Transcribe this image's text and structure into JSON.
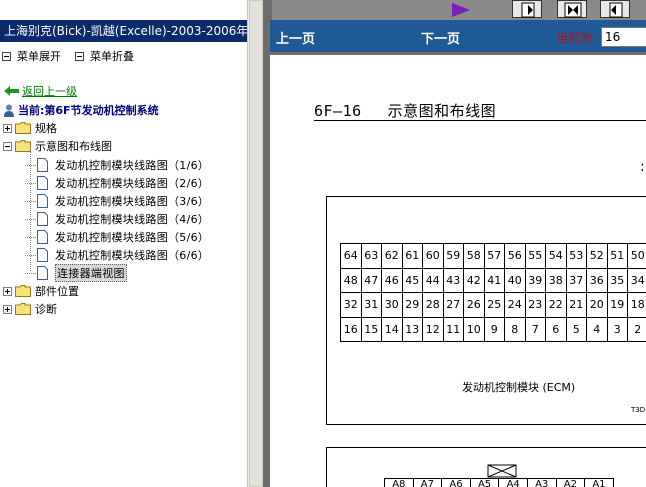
{
  "left_pane": {
    "title": "上海别克(Bick)-凯越(Excelle)-2003-2006年款",
    "expand_menu": "菜单展开",
    "collapse_menu": "菜单折叠",
    "back_link": "返回上一级",
    "current_section": "当前:第6F节发动机控制系统",
    "tree": [
      {
        "label": "规格",
        "state": "collapsed"
      },
      {
        "label": "示意图和布线图",
        "state": "expanded",
        "children": [
          "发动机控制模块线路图（1/6）",
          "发动机控制模块线路图（2/6）",
          "发动机控制模块线路图（3/6）",
          "发动机控制模块线路图（4/6）",
          "发动机控制模块线路图（5/6）",
          "发动机控制模块线路图（6/6）",
          "连接器端视图"
        ]
      },
      {
        "label": "部件位置",
        "state": "collapsed"
      },
      {
        "label": "诊断",
        "state": "collapsed"
      }
    ],
    "selected_item": "连接器端视图"
  },
  "right_pane": {
    "prev_page": "上一页",
    "next_page": "下一页",
    "current_label": "当前为",
    "current_page": "16"
  },
  "document": {
    "page_code": "6F–16",
    "title": "示意图和布线图",
    "corner_glyph": ":",
    "ecm_pins": [
      [
        "64",
        "63",
        "62",
        "61",
        "60",
        "59",
        "58",
        "57",
        "56",
        "55",
        "54",
        "53",
        "52",
        "51",
        "50"
      ],
      [
        "48",
        "47",
        "46",
        "45",
        "44",
        "43",
        "42",
        "41",
        "40",
        "39",
        "38",
        "37",
        "36",
        "35",
        "34"
      ],
      [
        "32",
        "31",
        "30",
        "29",
        "28",
        "27",
        "26",
        "25",
        "24",
        "23",
        "22",
        "21",
        "20",
        "19",
        "18"
      ],
      [
        "16",
        "15",
        "14",
        "13",
        "12",
        "11",
        "10",
        "9",
        "8",
        "7",
        "6",
        "5",
        "4",
        "3",
        "2"
      ]
    ],
    "ecm_label": "发动机控制模块 (ECM)",
    "ecm_code": "T3D",
    "connector_pins": [
      "A8",
      "A7",
      "A6",
      "A5",
      "A4",
      "A3",
      "A2",
      "A1"
    ]
  },
  "icons": {
    "toolbar": [
      "play-triangle-icon",
      "nav-first-icon",
      "nav-prev-icon",
      "nav-next-icon"
    ]
  },
  "colors": {
    "title_bar": "#0a2a6b",
    "nav_bar": "#1f5a94",
    "back_link": "#008000",
    "current_section": "#000080",
    "current_page_label": "#d40000"
  }
}
